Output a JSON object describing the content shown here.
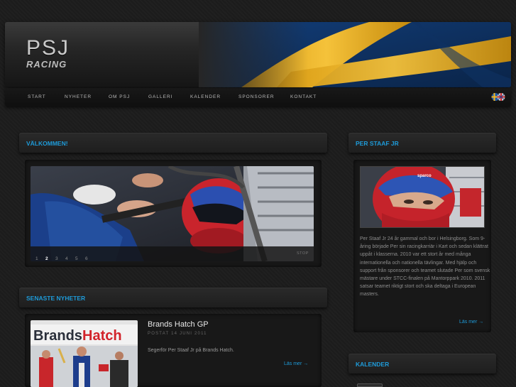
{
  "brand": {
    "logo_main": "PSJ",
    "logo_sub": "RACING"
  },
  "nav": {
    "items": [
      "START",
      "NYHETER",
      "OM PSJ",
      "GALLERI",
      "KALENDER",
      "SPONSORER",
      "KONTAKT"
    ]
  },
  "welcome": {
    "heading": "VÄLKOMMEN!",
    "pager": [
      "1",
      "2",
      "3",
      "4",
      "5",
      "6"
    ],
    "active_page": "2",
    "stop_label": "STOP"
  },
  "news": {
    "heading": "SENASTE NYHETER",
    "image_text": "BrandsHatch",
    "title": "Brands Hatch GP",
    "date": "POSTAT 14 JUNI 2011",
    "text": "Segerför Per Staaf Jr på Brands Hatch.",
    "read_more": "Läs mer →"
  },
  "profile": {
    "heading": "PER STAAF JR",
    "text": "Per Staaf Jr 24 år gammal och bor i Helsingborg. Som 9-åring började Per sin racingkarriär i Kart och sedan klättrat uppåt i klasserna. 2010 var ett stort år med många internationella och nationella tävlingar. Med hjälp och support från sponsorer och teamet slutade Per som svensk mästare under STCC-finalen på Mantorppark 2010. 2011 satsar teamet riktigt stort och ska deltaga i European masters.",
    "read_more": "Läs mer →"
  },
  "calendar": {
    "heading": "KALENDER"
  },
  "colors": {
    "accent": "#1e9bd9",
    "flag_blue": "#1f5aa8",
    "flag_yellow": "#f2b51f"
  }
}
